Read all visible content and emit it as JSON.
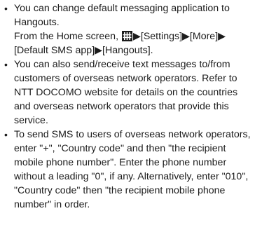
{
  "bullet_glyph": "•",
  "items": [
    {
      "lines": [
        "You can change default messaging application to",
        "Hangouts."
      ],
      "steps_prefix": "From the Home screen, ",
      "steps_icon": "apps-grid-icon",
      "steps_rest_line1": "▶[Settings]▶[More]▶",
      "steps_line2": "[Default SMS app]▶[Hangouts]."
    },
    {
      "lines": [
        "You can also send/receive text messages to/from",
        "customers of overseas network operators. Refer to",
        "NTT DOCOMO website for details on the countries",
        "and overseas network operators that provide this",
        "service."
      ]
    },
    {
      "lines": [
        "To send SMS to users of overseas network operators,",
        "enter \"+\", \"Country code\" and then \"the recipient",
        "mobile phone number\". Enter the phone number",
        "without a leading \"0\", if any. Alternatively, enter \"010\",",
        "\"Country code\" then \"the recipient mobile phone",
        "number\" in order."
      ]
    }
  ]
}
